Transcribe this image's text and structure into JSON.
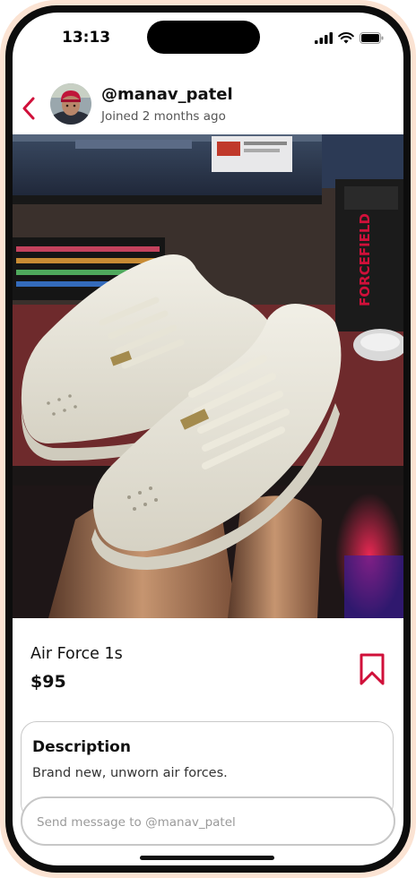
{
  "status_bar": {
    "time": "13:13",
    "icons": [
      "cellular-signal-icon",
      "wifi-icon",
      "battery-icon"
    ]
  },
  "header": {
    "back_icon": "chevron-left-icon",
    "username": "@manav_patel",
    "joined": "Joined 2 months ago"
  },
  "listing": {
    "title": "Air Force 1s",
    "price": "$95",
    "bookmark_icon": "bookmark-icon"
  },
  "description": {
    "heading": "Description",
    "text": "Brand new, unworn air forces."
  },
  "message": {
    "placeholder": "Send message to @manav_patel"
  },
  "photo_text": {
    "box_brand": "FORCEFIELD"
  },
  "colors": {
    "accent": "#d0103a",
    "phone_frame": "#fbe3d3"
  }
}
